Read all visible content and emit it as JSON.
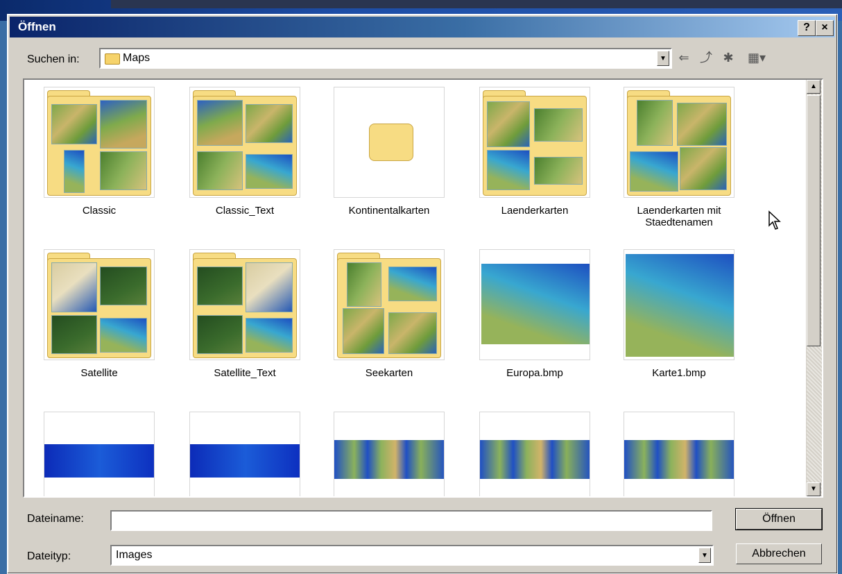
{
  "window": {
    "title": "Öffnen",
    "help_label": "?",
    "close_label": "×"
  },
  "toolbar": {
    "look_in_label": "Suchen in:",
    "look_in_value": "Maps",
    "icons": [
      "back-icon",
      "up-folder-icon",
      "new-folder-icon",
      "view-menu-icon"
    ]
  },
  "items": [
    {
      "name": "Classic",
      "kind": "folder"
    },
    {
      "name": "Classic_Text",
      "kind": "folder"
    },
    {
      "name": "Kontinentalkarten",
      "kind": "empty-folder"
    },
    {
      "name": "Laenderkarten",
      "kind": "folder"
    },
    {
      "name": "Laenderkarten mit Staedtenamen",
      "kind": "folder"
    },
    {
      "name": "Satellite",
      "kind": "folder"
    },
    {
      "name": "Satellite_Text",
      "kind": "folder"
    },
    {
      "name": "Seekarten",
      "kind": "folder"
    },
    {
      "name": "Europa.bmp",
      "kind": "image"
    },
    {
      "name": "Karte1.bmp",
      "kind": "image"
    }
  ],
  "form": {
    "filename_label": "Dateiname:",
    "filename_value": "",
    "filetype_label": "Dateityp:",
    "filetype_value": "Images",
    "open_label": "Öffnen",
    "cancel_label": "Abbrechen"
  }
}
